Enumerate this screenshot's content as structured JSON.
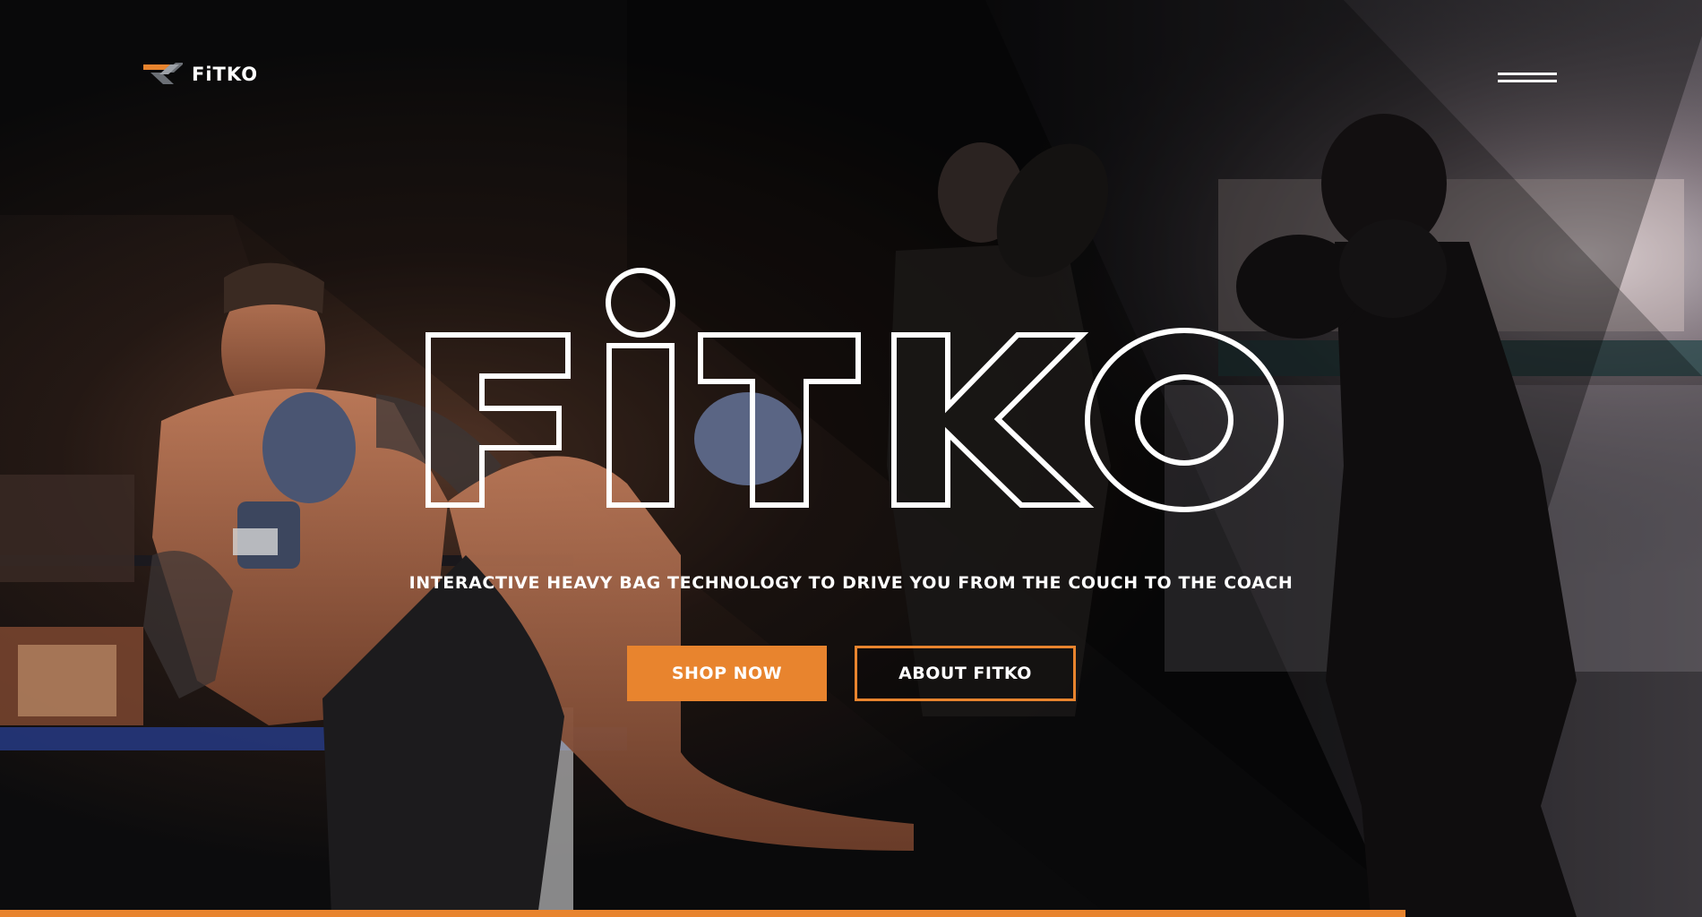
{
  "brand": {
    "logo_text": "FiTKO",
    "wordmark": "FiTKO"
  },
  "header": {
    "menu_icon": "hamburger-menu-icon"
  },
  "hero": {
    "tagline": "INTERACTIVE HEAVY BAG TECHNOLOGY TO DRIVE YOU FROM THE COUCH TO THE COACH",
    "primary_button": "SHOP NOW",
    "secondary_button": "ABOUT FITKO"
  },
  "colors": {
    "accent": "#e8842e",
    "text": "#ffffff",
    "background": "#0c0d0f"
  },
  "progress": {
    "value_percent": 82.6
  }
}
